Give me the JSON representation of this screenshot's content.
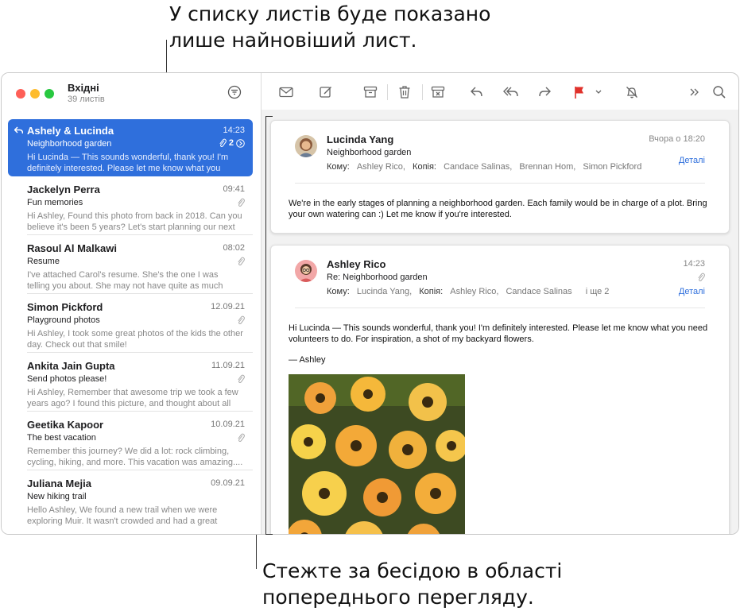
{
  "callouts": {
    "top_line1": "У списку листів буде показано",
    "top_line2": "лише найновіший лист.",
    "bottom_line1": "Стежте за бесідою в області",
    "bottom_line2": "попереднього перегляду."
  },
  "mailbox": {
    "title": "Вхідні",
    "count": "39 листів"
  },
  "messages": [
    {
      "sender": "Ashely & Lucinda",
      "date": "14:23",
      "subject": "Neighborhood garden",
      "preview": "Hi Lucinda — This sounds wonderful, thank you! I'm definitely interested. Please let me know what you nee...",
      "thread_count": "2",
      "selected": true,
      "replied": true
    },
    {
      "sender": "Jackelyn Perra",
      "date": "09:41",
      "subject": "Fun memories",
      "preview": "Hi Ashley, Found this photo from back in 2018. Can you believe it's been 5 years? Let's start planning our next ..."
    },
    {
      "sender": "Rasoul Al Malkawi",
      "date": "08:02",
      "subject": "Resume",
      "preview": "I've attached Carol's resume. She's the one I was telling you about. She may not have quite as much experienc..."
    },
    {
      "sender": "Simon Pickford",
      "date": "12.09.21",
      "subject": "Playground photos",
      "preview": "Hi Ashley, I took some great photos of the kids the other day. Check out that smile!"
    },
    {
      "sender": "Ankita Jain Gupta",
      "date": "11.09.21",
      "subject": "Send photos please!",
      "preview": "Hi Ashley, Remember that awesome trip we took a few years ago? I found this picture, and thought about all yo..."
    },
    {
      "sender": "Geetika Kapoor",
      "date": "10.09.21",
      "subject": "The best vacation",
      "preview": "Remember this journey? We did a lot: rock climbing, cycling, hiking, and more. This vacation was amazing...."
    },
    {
      "sender": "Juliana Mejia",
      "date": "09.09.21",
      "subject": "New hiking trail",
      "preview": "Hello Ashley, We found a new trail when we were exploring Muir. It wasn't crowded and had a great view...."
    }
  ],
  "toolbar": {
    "icons": [
      "envelope-icon",
      "compose-icon",
      "archive-icon",
      "trash-icon",
      "junk-icon",
      "reply-icon",
      "reply-all-icon",
      "forward-icon",
      "flag-icon",
      "flag-menu-icon",
      "mute-icon",
      "more-icon",
      "search-icon"
    ]
  },
  "thread": [
    {
      "sender": "Lucinda Yang",
      "date": "Вчора о 18:20",
      "subject": "Neighborhood garden",
      "to_label": "Кому:",
      "to": "Ashley Rico,",
      "cc_label": "Копія:",
      "cc": [
        "Candace Salinas,",
        "Brennan Hom,",
        "Simon Pickford"
      ],
      "details": "Деталі",
      "body": "We're in the early stages of planning a neighborhood garden. Each family would be in charge of a plot. Bring your own watering can :) Let me know if you're interested."
    },
    {
      "sender": "Ashley Rico",
      "date": "14:23",
      "subject": "Re: Neighborhood garden",
      "to_label": "Кому:",
      "to": "Lucinda Yang,",
      "cc_label": "Копія:",
      "cc": [
        "Ashley Rico,",
        "Candace Salinas"
      ],
      "more": "і ще 2",
      "details": "Деталі",
      "body": "Hi Lucinda — This sounds wonderful, thank you! I'm definitely interested. Please let me know what you need volunteers to do. For inspiration, a shot of my backyard flowers.",
      "signature": "— Ashley"
    }
  ],
  "colors": {
    "accent": "#2f6fdc",
    "flag": "#e0312b"
  }
}
